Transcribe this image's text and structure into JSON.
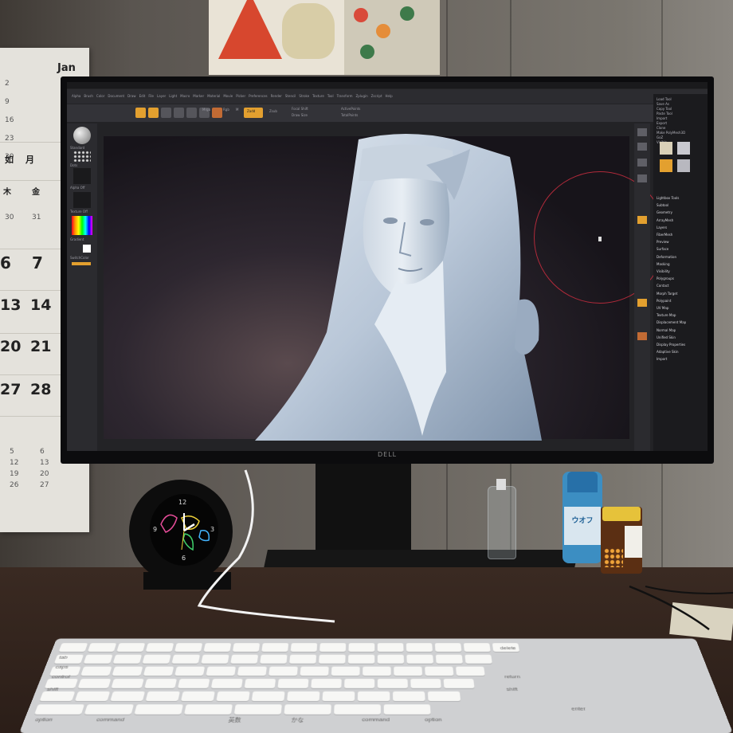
{
  "calendar": {
    "month": "Jan",
    "weekdays": [
      "如",
      "月",
      "木",
      "金"
    ],
    "dates": [
      "6",
      "7",
      "13",
      "14",
      "20",
      "21",
      "27",
      "28"
    ],
    "small_top": [
      "2",
      "9",
      "16",
      "23",
      "30"
    ],
    "small_mid": [
      "30",
      "31"
    ],
    "small_bottom": [
      "5",
      "12",
      "19",
      "26"
    ],
    "small_bottom2": [
      "6",
      "13",
      "20",
      "27"
    ]
  },
  "monitor": {
    "brand": "DELL"
  },
  "app": {
    "menu_items": [
      "Alpha",
      "Brush",
      "Color",
      "Document",
      "Draw",
      "Edit",
      "File",
      "Layer",
      "Light",
      "Macro",
      "Marker",
      "Material",
      "Movie",
      "Picker",
      "Preferences",
      "Render",
      "Stencil",
      "Stroke",
      "Texture",
      "Tool",
      "Transform",
      "Zplugin",
      "Zscript",
      "Help"
    ],
    "left_shelf": [
      "Standard",
      "Dots",
      "Alpha Off",
      "Texture Off",
      "Gradient",
      "SwitchColor"
    ],
    "toolbar_labels": [
      "Mrgb",
      "Rgb",
      "M",
      "Zadd",
      "Zsub",
      "Focal Shift",
      "Draw Size",
      "ActivePoints",
      "TotalPoints"
    ],
    "tray_items": [
      "Load Tool",
      "Save As",
      "Copy Tool",
      "Paste Tool",
      "Import",
      "Export",
      "Clone",
      "Make PolyMesh3D",
      "GoZ",
      "Visible",
      "Lightbox Tools",
      "Subtool",
      "Geometry",
      "ArrayMesh",
      "Layers",
      "FiberMesh",
      "Preview",
      "Surface",
      "Deformation",
      "Masking",
      "Visibility",
      "Polygroups",
      "Contact",
      "Morph Target",
      "Polypaint",
      "UV Map",
      "Texture Map",
      "Displacement Map",
      "Normal Map",
      "Unified Skin",
      "Display Properties",
      "Adaptive Skin",
      "Import"
    ]
  },
  "clock": {
    "numerals": [
      "12",
      "3",
      "6",
      "9"
    ]
  },
  "bottle_label": "ウオフ",
  "keyboard": {
    "labels": [
      "control",
      "shift",
      "option",
      "command",
      "英数",
      "かな",
      "command",
      "option",
      "caps",
      "tab",
      "return",
      "shift",
      "delete",
      "enter"
    ]
  },
  "colors": {
    "sculpt_light": "#d8e2ec",
    "sculpt_shadow": "#7f93ab",
    "brush_circle": "#b02a3a",
    "zbrush_orange": "#e3a02f"
  }
}
